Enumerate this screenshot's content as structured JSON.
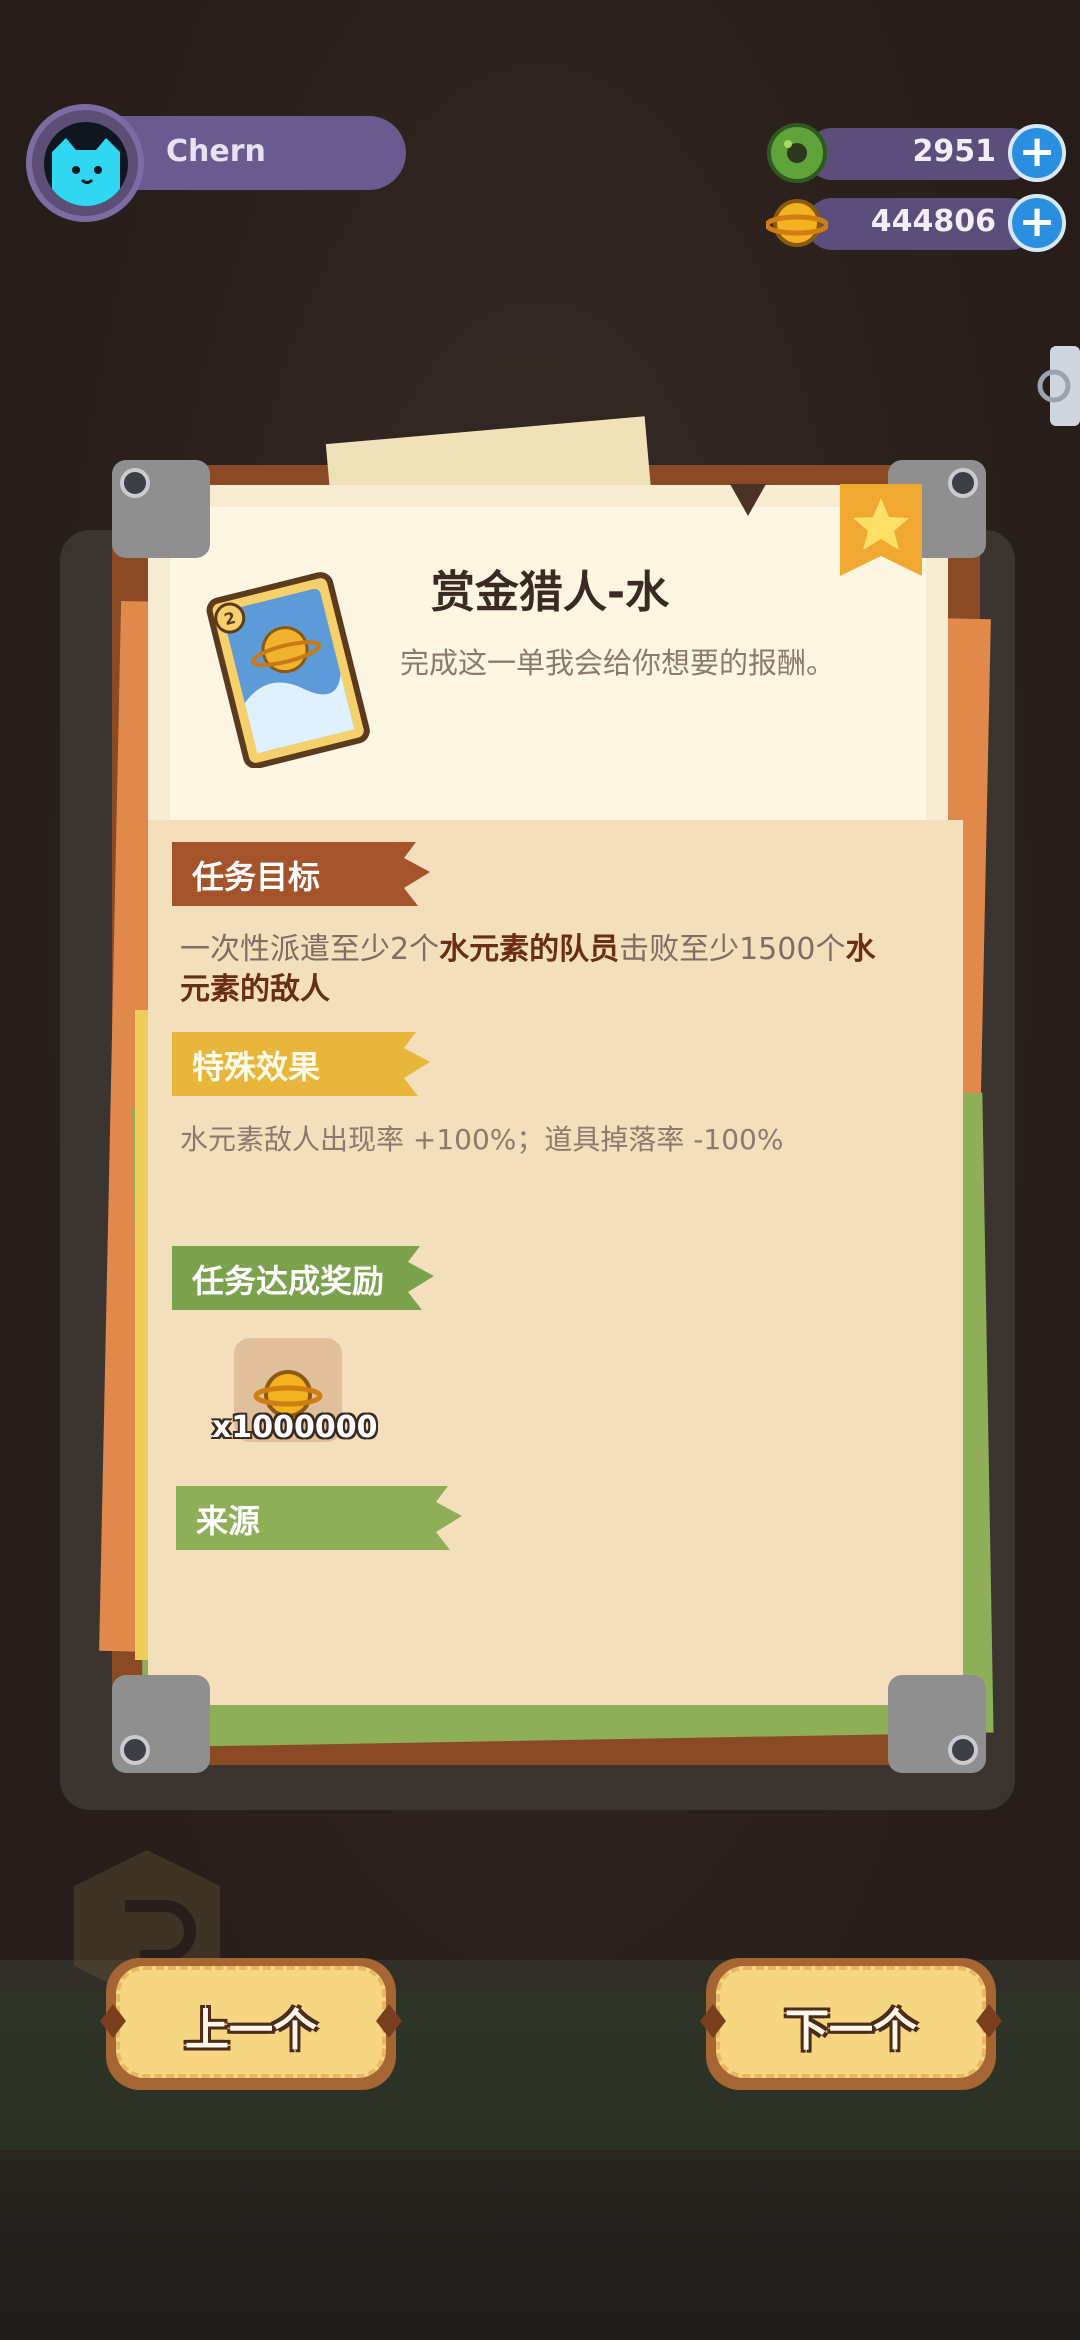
{
  "player": {
    "name": "Chern"
  },
  "currencies": [
    {
      "icon": "green-donut-coin-icon",
      "value": "2951"
    },
    {
      "icon": "gold-planet-coin-icon",
      "value": "444806"
    }
  ],
  "mission": {
    "title": "赏金猎人-水",
    "description": "完成这一单我会给你想要的报酬。",
    "card_level": "2"
  },
  "sections": {
    "goal_label": "任务目标",
    "goal_text_1": "一次性派遣至少2个",
    "goal_text_2": "水元素的队员",
    "goal_text_3": "击败至少1500个",
    "goal_text_4": "水",
    "goal_text_5": "元素的敌人",
    "effect_label": "特殊效果",
    "effect_text": "水元素敌人出现率 +100%；道具掉落率 -100%",
    "reward_label": "任务达成奖励",
    "reward_qty": "x1000000",
    "source_label": "来源"
  },
  "nav": {
    "prev_label": "上一个",
    "next_label": "下一个"
  },
  "colors": {
    "goal_tag": "#a4532a",
    "effect_tag": "#e9b63c",
    "reward_tag": "#7da24e",
    "source_tag": "#8fae58"
  }
}
